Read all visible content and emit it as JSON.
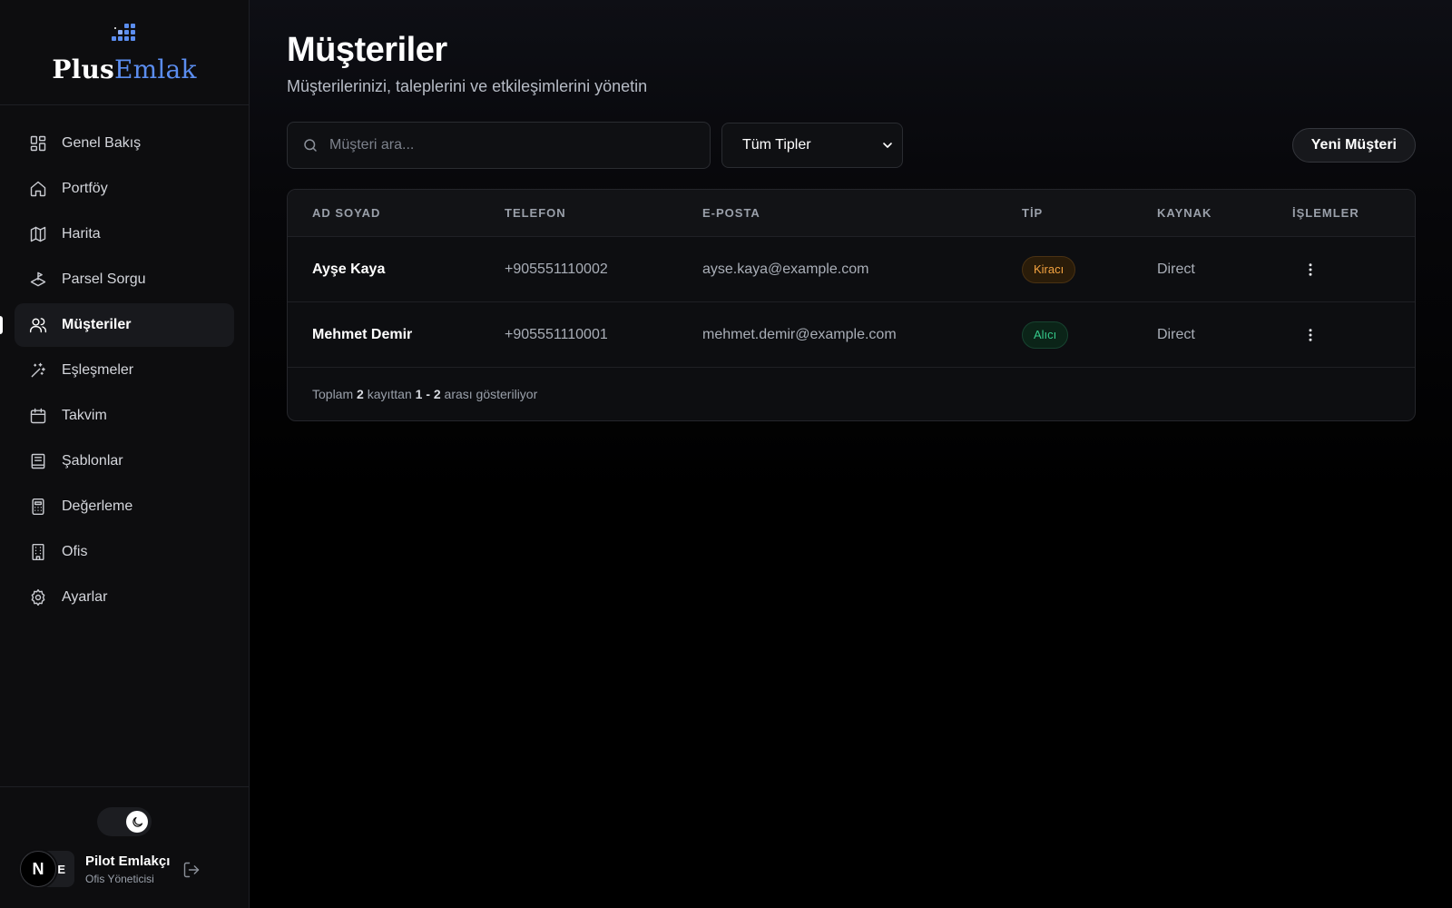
{
  "brand": {
    "name_part1": "Plus",
    "name_part2": "Emlak"
  },
  "sidebar": {
    "items": [
      {
        "label": "Genel Bakış",
        "icon": "dashboard-icon"
      },
      {
        "label": "Portföy",
        "icon": "home-icon"
      },
      {
        "label": "Harita",
        "icon": "map-icon"
      },
      {
        "label": "Parsel Sorgu",
        "icon": "land-parcel-icon"
      },
      {
        "label": "Müşteriler",
        "icon": "users-icon",
        "active": true
      },
      {
        "label": "Eşleşmeler",
        "icon": "sparkles-icon"
      },
      {
        "label": "Takvim",
        "icon": "calendar-icon"
      },
      {
        "label": "Şablonlar",
        "icon": "template-icon"
      },
      {
        "label": "Değerleme",
        "icon": "calculator-icon"
      },
      {
        "label": "Ofis",
        "icon": "building-icon"
      },
      {
        "label": "Ayarlar",
        "icon": "settings-icon"
      }
    ]
  },
  "user": {
    "badge": "N",
    "initials": "E",
    "name": "Pilot Emlakçı",
    "role": "Ofis Yöneticisi"
  },
  "header": {
    "title": "Müşteriler",
    "subtitle": "Müşterilerinizi, taleplerini ve etkileşimlerini yönetin"
  },
  "toolbar": {
    "search_placeholder": "Müşteri ara...",
    "search_value": "",
    "type_filter": "Tüm Tipler",
    "new_button": "Yeni Müşteri"
  },
  "table": {
    "columns": [
      "AD SOYAD",
      "TELEFON",
      "E-POSTA",
      "TİP",
      "KAYNAK",
      "İŞLEMLER"
    ],
    "rows": [
      {
        "name": "Ayşe Kaya",
        "phone": "+905551110002",
        "email": "ayse.kaya@example.com",
        "type": "Kiracı",
        "type_color": "#f4a340",
        "source": "Direct"
      },
      {
        "name": "Mehmet Demir",
        "phone": "+905551110001",
        "email": "mehmet.demir@example.com",
        "type": "Alıcı",
        "type_color": "#35c98a",
        "source": "Direct"
      }
    ],
    "footer": {
      "prefix": "Toplam",
      "total": "2",
      "middle": "kayıttan",
      "range": "1 - 2",
      "suffix": "arası gösteriliyor"
    }
  },
  "colors": {
    "accent": "#5b8def",
    "background": "#000000",
    "sidebar": "#0d0d0f"
  }
}
